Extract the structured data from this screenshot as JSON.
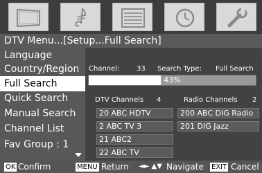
{
  "icons": [
    {
      "name": "tv-icon"
    },
    {
      "name": "music-note-icon"
    },
    {
      "name": "list-grid-icon"
    },
    {
      "name": "clock-icon"
    },
    {
      "name": "wrench-icon"
    }
  ],
  "breadcrumb": "DTV Menu...[Setup...Full Search]",
  "menu": {
    "items": [
      {
        "label": "Language"
      },
      {
        "label": "Country/Region"
      },
      {
        "label": "Full Search",
        "selected": true
      },
      {
        "label": "Quick Search"
      },
      {
        "label": "Manual Search"
      },
      {
        "label": "Channel List"
      },
      {
        "label": "Fav Group : 1"
      }
    ]
  },
  "search": {
    "channel_label": "Channel:",
    "channel_value": "33",
    "type_label": "Search Type:",
    "type_value": "Full Search",
    "progress_text": "43%",
    "progress_percent": 43,
    "dtv_label": "DTV Channels",
    "dtv_count": "4",
    "radio_label": "Radio Channels",
    "radio_count": "2",
    "dtv_channels": [
      "20  ABC HDTV",
      "2  ABC TV 3",
      "21  ABC2",
      "22  ABC TV"
    ],
    "radio_channels": [
      "200 ABC DIG Radio",
      "201 DIG Jazz"
    ]
  },
  "help": {
    "ok_key": "OK",
    "ok_label": "Confirm",
    "menu_key": "MENU",
    "menu_label": "Return",
    "nav_glyph": "◄► ▲▼",
    "nav_label": "Navigate",
    "exit_key": "EXIT",
    "exit_label": "Cancel"
  },
  "colors": {
    "selected_bg": "#ffffff",
    "panel_bg": "#424242",
    "menu_bg": "#585858"
  }
}
